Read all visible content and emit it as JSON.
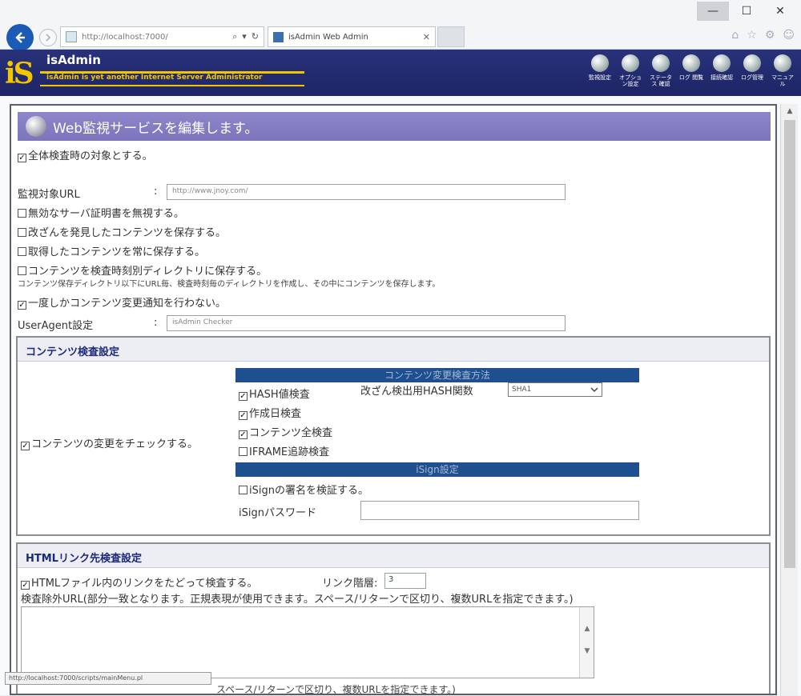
{
  "browser": {
    "window_controls": [
      "—",
      "☐",
      "✕"
    ],
    "url": "http://localhost:7000/",
    "address_tools": [
      "⌕",
      "▾",
      "↻"
    ],
    "tab_title": "isAdmin Web Admin",
    "tab_close": "✕",
    "toolbar_icons": [
      "home-icon",
      "star-icon",
      "settings-icon",
      "smiley-icon"
    ]
  },
  "header": {
    "logo": "iS",
    "title": "isAdmin",
    "subtitle": "isAdmin is yet another Internet Server Administrator",
    "nav": [
      {
        "label": "監視設定",
        "icon": "monitor-icon"
      },
      {
        "label": "オプション設定",
        "icon": "options-icon"
      },
      {
        "label": "ステータス 確認",
        "icon": "status-icon"
      },
      {
        "label": "ログ 閲覧",
        "icon": "log-icon"
      },
      {
        "label": "接続確認",
        "icon": "connect-icon"
      },
      {
        "label": "ログ管理",
        "icon": "log-manage-icon"
      },
      {
        "label": "マニュアル",
        "icon": "manual-icon"
      }
    ]
  },
  "page": {
    "heading": "Web監視サービスを編集します。",
    "global_check": "全体検査時の対象とする。",
    "url_label": "監視対象URL",
    "url_sep": ":",
    "url_value": "http://www.jnoy.com/",
    "opt_ignore_cert": "無効なサーバ証明書を無視する。",
    "opt_save_tampered": "改ざんを発見したコンテンツを保存する。",
    "opt_save_always": "取得したコンテンツを常に保存する。",
    "opt_save_dir": "コンテンツを検査時刻別ディレクトリに保存する。",
    "opt_save_dir_note": "コンテンツ保存ディレクトリ以下にURL毎、検査時刻毎のディレクトリを作成し、その中にコンテンツを保存します。",
    "opt_notify_once": "一度しかコンテンツ変更通知を行わない。",
    "ua_label": "UserAgent設定",
    "ua_sep": ":",
    "ua_value": "isAdmin Checker"
  },
  "content_check": {
    "title": "コンテンツ検査設定",
    "check_changes": "コンテンツの変更をチェックする。",
    "method_band": "コンテンツ変更検査方法",
    "hash_check": "HASH値検査",
    "hash_algo_label": "改ざん検出用HASH関数",
    "hash_algo_value": "SHA1",
    "date_check": "作成日検査",
    "full_check": "コンテンツ全検査",
    "iframe_check": "IFRAME追跡検査",
    "sign_band": "iSign設定",
    "sign_verify": "iSignの署名を検証する。",
    "sign_password_label": "iSignパスワード",
    "sign_password_value": ""
  },
  "link_check": {
    "title": "HTMLリンク先検査設定",
    "follow_links": "HTMLファイル内のリンクをたどって検査する。",
    "depth_label": "リンク階層:",
    "depth_value": "3",
    "exclude_note": "検査除外URL(部分一致となります。正規表現が使用できます。スペース/リターンで区切り、複数URLを指定できます。)",
    "exclude_value": ""
  },
  "status": {
    "tooltip": "http://localhost:7000/scripts/mainMenu.pl",
    "bottom_text": "スペース/リターンで区切り、複数URLを指定できます。)"
  }
}
